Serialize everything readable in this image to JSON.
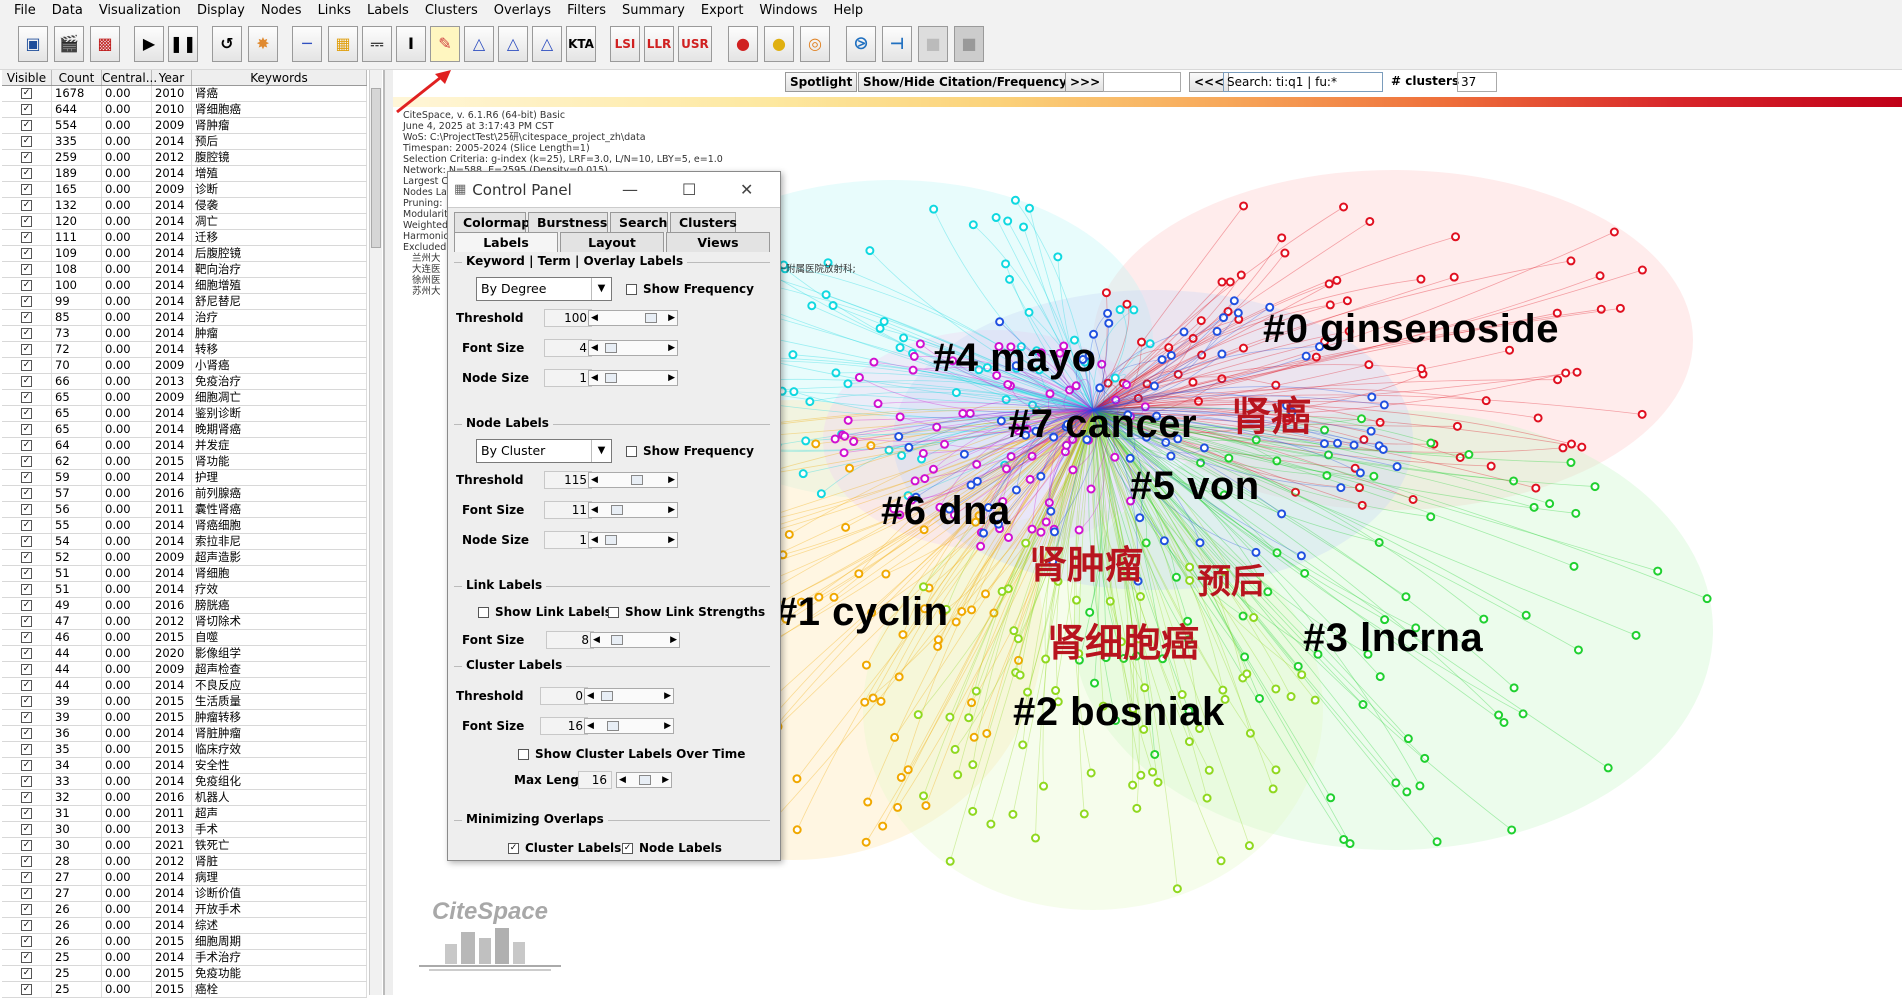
{
  "menu": [
    "File",
    "Data",
    "Visualization",
    "Display",
    "Nodes",
    "Links",
    "Labels",
    "Clusters",
    "Overlays",
    "Filters",
    "Summary",
    "Export",
    "Windows",
    "Help"
  ],
  "toolbar": {
    "lsi": "LSI",
    "llr": "LLR",
    "usr": "USR",
    "kta": "KTA"
  },
  "table": {
    "headers": [
      "Visible",
      "Count",
      "Central...",
      "Year",
      "Keywords"
    ],
    "rows": [
      [
        "1678",
        "0.00",
        "2010",
        "肾癌"
      ],
      [
        "644",
        "0.00",
        "2010",
        "肾细胞癌"
      ],
      [
        "554",
        "0.00",
        "2009",
        "肾肿瘤"
      ],
      [
        "335",
        "0.00",
        "2014",
        "预后"
      ],
      [
        "259",
        "0.00",
        "2012",
        "腹腔镜"
      ],
      [
        "189",
        "0.00",
        "2014",
        "增殖"
      ],
      [
        "165",
        "0.00",
        "2009",
        "诊断"
      ],
      [
        "132",
        "0.00",
        "2014",
        "侵袭"
      ],
      [
        "120",
        "0.00",
        "2014",
        "凋亡"
      ],
      [
        "111",
        "0.00",
        "2014",
        "迁移"
      ],
      [
        "109",
        "0.00",
        "2014",
        "后腹腔镜"
      ],
      [
        "108",
        "0.00",
        "2014",
        "靶向治疗"
      ],
      [
        "100",
        "0.00",
        "2014",
        "细胞增殖"
      ],
      [
        "99",
        "0.00",
        "2014",
        "舒尼替尼"
      ],
      [
        "85",
        "0.00",
        "2014",
        "治疗"
      ],
      [
        "73",
        "0.00",
        "2014",
        "肿瘤"
      ],
      [
        "72",
        "0.00",
        "2014",
        "转移"
      ],
      [
        "70",
        "0.00",
        "2009",
        "小肾癌"
      ],
      [
        "66",
        "0.00",
        "2013",
        "免疫治疗"
      ],
      [
        "65",
        "0.00",
        "2009",
        "细胞凋亡"
      ],
      [
        "65",
        "0.00",
        "2014",
        "鉴别诊断"
      ],
      [
        "65",
        "0.00",
        "2014",
        "晚期肾癌"
      ],
      [
        "64",
        "0.00",
        "2014",
        "并发症"
      ],
      [
        "62",
        "0.00",
        "2015",
        "肾功能"
      ],
      [
        "59",
        "0.00",
        "2014",
        "护理"
      ],
      [
        "57",
        "0.00",
        "2016",
        "前列腺癌"
      ],
      [
        "56",
        "0.00",
        "2011",
        "囊性肾癌"
      ],
      [
        "55",
        "0.00",
        "2014",
        "肾癌细胞"
      ],
      [
        "54",
        "0.00",
        "2014",
        "索拉非尼"
      ],
      [
        "52",
        "0.00",
        "2009",
        "超声造影"
      ],
      [
        "51",
        "0.00",
        "2014",
        "肾细胞"
      ],
      [
        "51",
        "0.00",
        "2014",
        "疗效"
      ],
      [
        "49",
        "0.00",
        "2016",
        "膀胱癌"
      ],
      [
        "47",
        "0.00",
        "2012",
        "肾切除术"
      ],
      [
        "46",
        "0.00",
        "2015",
        "自噬"
      ],
      [
        "44",
        "0.00",
        "2020",
        "影像组学"
      ],
      [
        "44",
        "0.00",
        "2009",
        "超声检查"
      ],
      [
        "44",
        "0.00",
        "2014",
        "不良反应"
      ],
      [
        "39",
        "0.00",
        "2015",
        "生活质量"
      ],
      [
        "39",
        "0.00",
        "2015",
        "肿瘤转移"
      ],
      [
        "36",
        "0.00",
        "2014",
        "肾脏肿瘤"
      ],
      [
        "35",
        "0.00",
        "2015",
        "临床疗效"
      ],
      [
        "34",
        "0.00",
        "2014",
        "安全性"
      ],
      [
        "33",
        "0.00",
        "2014",
        "免疫组化"
      ],
      [
        "32",
        "0.00",
        "2016",
        "机器人"
      ],
      [
        "31",
        "0.00",
        "2011",
        "超声"
      ],
      [
        "30",
        "0.00",
        "2013",
        "手术"
      ],
      [
        "30",
        "0.00",
        "2021",
        "铁死亡"
      ],
      [
        "28",
        "0.00",
        "2012",
        "肾脏"
      ],
      [
        "27",
        "0.00",
        "2014",
        "病理"
      ],
      [
        "27",
        "0.00",
        "2014",
        "诊断价值"
      ],
      [
        "26",
        "0.00",
        "2014",
        "开放手术"
      ],
      [
        "26",
        "0.00",
        "2014",
        "综述"
      ],
      [
        "26",
        "0.00",
        "2015",
        "细胞周期"
      ],
      [
        "25",
        "0.00",
        "2014",
        "手术治疗"
      ],
      [
        "25",
        "0.00",
        "2015",
        "免疫功能"
      ],
      [
        "25",
        "0.00",
        "2015",
        "癌栓"
      ]
    ]
  },
  "searchbar": {
    "spotlight": "Spotlight",
    "burst": "Show/Hide Citation/Frequency Burst",
    "next": ">>>",
    "prev": "<<<",
    "search_value": "Search: ti:q1 | fu:*",
    "clusters_label": "# clusters",
    "clusters_value": "37"
  },
  "meta_text": "CiteSpace, v. 6.1.R6 (64-bit) Basic\nJune 4, 2025 at 3:17:43 PM CST\nWoS: C:\\ProjectTest\\25研\\citespace_project_zh\\data\nTimespan: 2005-2024 (Slice Length=1)\nSelection Criteria: g-index (k=25), LRF=3.0, L/N=10, LBY=5, e=1.0\nNetwork: N=588, E=2595 (Density=0.015)\nLargest CC: 557 (94%)\nNodes La\nPruning:\nModularit\nWeighted\nHarmonic\nExcluded\n   兰州大\n   大连医                                                              附属医院泌尿外科; 广西医科大学第一附属医院放射科;\n   徐州医                                                              中心; 江苏大学附属医院泌尿外科;\n   苏州大",
  "clusters": [
    {
      "label": "#0 ginsenoside",
      "color": "#c0101e"
    },
    {
      "label": "#4 mayo",
      "color": "#22b0a0"
    },
    {
      "label": "#7 cancer",
      "color": "#b01aa8"
    },
    {
      "label": "#5 von",
      "color": "#2058c8"
    },
    {
      "label": "#6 dna",
      "color": "#2a1aa0"
    },
    {
      "label": "#1 cyclin",
      "color": "#c09020"
    },
    {
      "label": "#3 lncrna",
      "color": "#1aa01a"
    },
    {
      "label": "#2 bosniak",
      "color": "#78b410"
    }
  ],
  "node_labels": [
    "肾癌",
    "肾肿瘤",
    "预后",
    "肾细胞癌"
  ],
  "logo_text": "CiteSpace",
  "control_panel": {
    "title": "Control Panel",
    "tabs_row1": [
      "Colormap",
      "Burstness",
      "Search",
      "Clusters"
    ],
    "tabs_row2": [
      "Labels",
      "Layout",
      "Views"
    ],
    "keyword_section": "Keyword | Term | Overlay Labels",
    "kw_sort": "By Degree",
    "show_frequency": "Show Frequency",
    "threshold_label": "Threshold",
    "font_size_label": "Font Size",
    "node_size_label": "Node Size",
    "kw_threshold": "100",
    "kw_font_size": "4",
    "kw_node_size": "1",
    "node_section": "Node Labels",
    "nl_sort": "By Cluster",
    "nl_threshold": "115",
    "nl_font_size": "11",
    "nl_node_size": "1",
    "link_section": "Link Labels",
    "show_link_labels": "Show Link Labels",
    "show_link_strengths": "Show Link Strengths",
    "link_font_size": "8",
    "cluster_section": "Cluster Labels",
    "cl_threshold": "0",
    "cl_font_size": "16",
    "show_over_time": "Show Cluster Labels Over Time",
    "max_length_label": "Max Length",
    "max_length": "16",
    "min_section": "Minimizing Overlaps",
    "min_cluster_labels": "Cluster Labels",
    "min_node_labels": "Node Labels"
  }
}
